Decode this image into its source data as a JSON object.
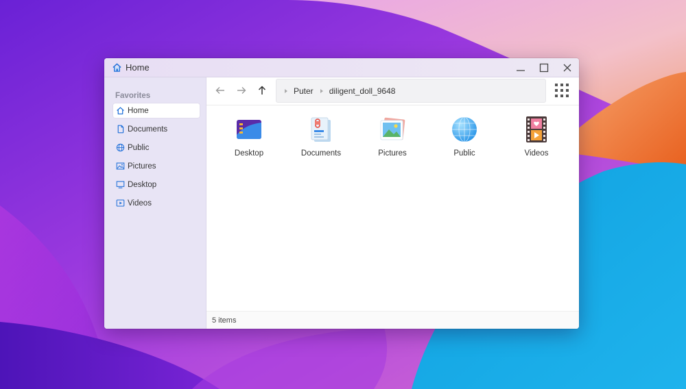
{
  "window": {
    "title": "Home"
  },
  "sidebar": {
    "heading": "Favorites",
    "items": [
      {
        "label": "Home",
        "icon": "home-icon",
        "active": true
      },
      {
        "label": "Documents",
        "icon": "document-icon"
      },
      {
        "label": "Public",
        "icon": "globe-icon"
      },
      {
        "label": "Pictures",
        "icon": "image-icon"
      },
      {
        "label": "Desktop",
        "icon": "monitor-icon"
      },
      {
        "label": "Videos",
        "icon": "video-icon"
      }
    ]
  },
  "path": {
    "segments": [
      "Puter",
      "diligent_doll_9648"
    ]
  },
  "files": [
    {
      "label": "Desktop",
      "icon": "desktop-folder-icon"
    },
    {
      "label": "Documents",
      "icon": "documents-folder-icon"
    },
    {
      "label": "Pictures",
      "icon": "pictures-folder-icon"
    },
    {
      "label": "Public",
      "icon": "public-folder-icon"
    },
    {
      "label": "Videos",
      "icon": "videos-folder-icon"
    }
  ],
  "status": {
    "text": "5 items"
  },
  "colors": {
    "accent": "#1e6fd9",
    "sidebar_bg": "#e8e4f5"
  }
}
